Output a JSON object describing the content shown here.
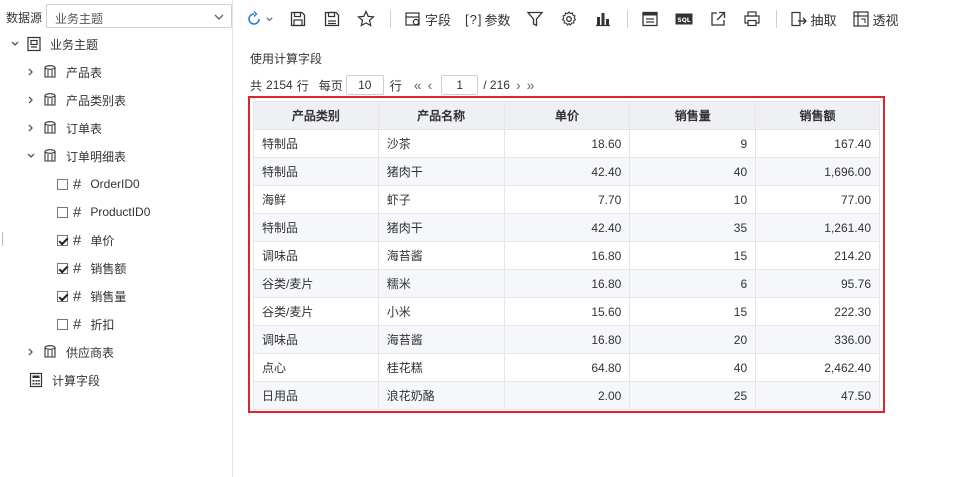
{
  "datasource": {
    "label": "数据源",
    "selected": "业务主题"
  },
  "tree": {
    "root": "业务主题",
    "tables": [
      "产品表",
      "产品类别表",
      "订单表",
      "订单明细表"
    ],
    "fields": [
      {
        "name": "OrderID0",
        "checked": false
      },
      {
        "name": "ProductID0",
        "checked": false
      },
      {
        "name": "单价",
        "checked": true
      },
      {
        "name": "销售额",
        "checked": true
      },
      {
        "name": "销售量",
        "checked": true
      },
      {
        "name": "折扣",
        "checked": false
      }
    ],
    "supplier": "供应商表",
    "calc": "计算字段"
  },
  "toolbar": {
    "field_label": "字段",
    "param_label": "参数",
    "extract_label": "抽取",
    "pivot_label": "透视"
  },
  "content": {
    "title": "使用计算字段"
  },
  "pager": {
    "total_prefix": "共",
    "total_value": "2154",
    "total_suffix": "行",
    "per_page_label": "每页",
    "per_page": "10",
    "per_page_unit": "行",
    "current_page": "1",
    "page_total": "/ 216"
  },
  "table": {
    "headers": [
      "产品类别",
      "产品名称",
      "单价",
      "销售量",
      "销售额"
    ],
    "rows": [
      [
        "特制品",
        "沙茶",
        "18.60",
        "9",
        "167.40"
      ],
      [
        "特制品",
        "猪肉干",
        "42.40",
        "40",
        "1,696.00"
      ],
      [
        "海鲜",
        "虾子",
        "7.70",
        "10",
        "77.00"
      ],
      [
        "特制品",
        "猪肉干",
        "42.40",
        "35",
        "1,261.40"
      ],
      [
        "调味品",
        "海苔酱",
        "16.80",
        "15",
        "214.20"
      ],
      [
        "谷类/麦片",
        "糯米",
        "16.80",
        "6",
        "95.76"
      ],
      [
        "谷类/麦片",
        "小米",
        "15.60",
        "15",
        "222.30"
      ],
      [
        "调味品",
        "海苔酱",
        "16.80",
        "20",
        "336.00"
      ],
      [
        "点心",
        "桂花糕",
        "64.80",
        "40",
        "2,462.40"
      ],
      [
        "日用品",
        "浪花奶酪",
        "2.00",
        "25",
        "47.50"
      ]
    ]
  }
}
